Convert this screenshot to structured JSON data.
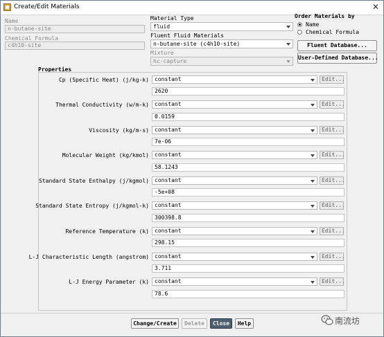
{
  "window": {
    "title": "Create/Edit Materials"
  },
  "left": {
    "name_label": "Name",
    "name_value": "n-butane-site",
    "formula_label": "Chemical Formula",
    "formula_value": "c4h10-site"
  },
  "center": {
    "material_type_label": "Material Type",
    "material_type_value": "fluid",
    "fluent_fluid_label": "Fluent Fluid Materials",
    "fluent_fluid_value": "n-butane-site (c4h10-site)",
    "mixture_label": "Mixture",
    "mixture_value": "hc-capture"
  },
  "order": {
    "label": "Order Materials by",
    "options": [
      {
        "label": "Name",
        "selected": true
      },
      {
        "label": "Chemical Formula",
        "selected": false
      }
    ]
  },
  "side_buttons": {
    "fluent_db": "Fluent Database...",
    "user_db": "User-Defined Database..."
  },
  "properties": {
    "label": "Properties",
    "items": [
      {
        "label": "Cp (Specific Heat) (j/kg-k)",
        "method": "constant",
        "edit": "Edit...",
        "value": "2620"
      },
      {
        "label": "Thermal Conductivity (w/m-k)",
        "method": "constant",
        "edit": "Edit...",
        "value": "0.0159"
      },
      {
        "label": "Viscosity (kg/m-s)",
        "method": "constant",
        "edit": "Edit...",
        "value": "7e-06"
      },
      {
        "label": "Molecular Weight (kg/kmol)",
        "method": "constant",
        "edit": "Edit...",
        "value": "58.1243"
      },
      {
        "label": "Standard State Enthalpy (j/kgmol)",
        "method": "constant",
        "edit": "Edit...",
        "value": "-5e+08"
      },
      {
        "label": "Standard State Entropy (j/kgmol-k)",
        "method": "constant",
        "edit": "Edit...",
        "value": "300398.8"
      },
      {
        "label": "Reference Temperature (k)",
        "method": "constant",
        "edit": "Edit...",
        "value": "298.15"
      },
      {
        "label": "L-J Characteristic Length (angstrom)",
        "method": "constant",
        "edit": "Edit...",
        "value": "3.711"
      },
      {
        "label": "L-J Energy Parameter (k)",
        "method": "constant",
        "edit": "Edit...",
        "value": "78.6"
      }
    ]
  },
  "footer": {
    "change_create": "Change/Create",
    "delete": "Delete",
    "close": "Close",
    "help": "Help"
  },
  "watermark": {
    "text": "南流坊"
  },
  "colors": {
    "primary_button": "#4d5f6e",
    "frame_border": "#c6c6c6"
  }
}
